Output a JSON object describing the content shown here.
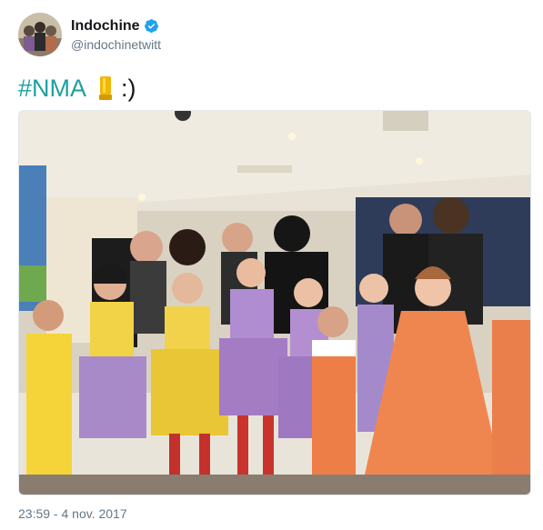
{
  "tweet": {
    "display_name": "Indochine",
    "handle": "@indochinetwitt",
    "hashtag": "#NMA",
    "emoji": "trophy-emoji",
    "suffix": ":)",
    "timestamp": "23:59 - 4 nov. 2017"
  },
  "colors": {
    "hashtag": "#1da1a1",
    "verified": "#1da1f2",
    "muted": "#657786"
  }
}
